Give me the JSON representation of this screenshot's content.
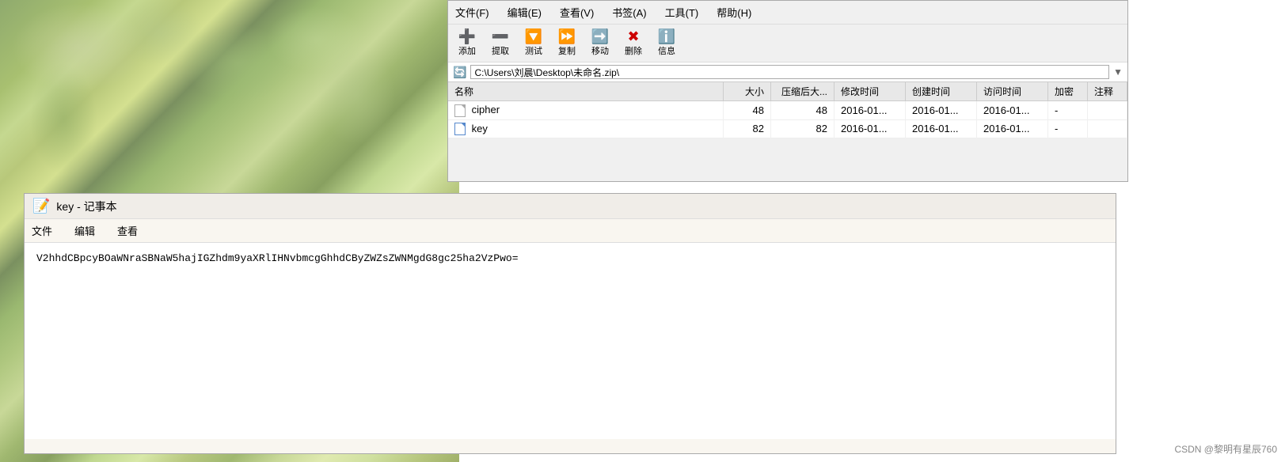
{
  "background": {
    "description": "Impressionist painting background"
  },
  "winrar": {
    "menubar": {
      "items": [
        "文件(F)",
        "编辑(E)",
        "查看(V)",
        "书签(A)",
        "工具(T)",
        "帮助(H)"
      ]
    },
    "toolbar": {
      "buttons": [
        {
          "label": "添加",
          "icon": "+",
          "color": "add"
        },
        {
          "label": "提取",
          "icon": "—",
          "color": "extract"
        },
        {
          "label": "测试",
          "icon": "✓",
          "color": "test"
        },
        {
          "label": "复制",
          "icon": "⇒",
          "color": "copy"
        },
        {
          "label": "移动",
          "icon": "→",
          "color": "move"
        },
        {
          "label": "删除",
          "icon": "✕",
          "color": "delete"
        },
        {
          "label": "信息",
          "icon": "ℹ",
          "color": "info"
        }
      ]
    },
    "path": "C:\\Users\\刘晨\\Desktop\\未命名.zip\\",
    "table": {
      "columns": [
        "名称",
        "大小",
        "压缩后大...",
        "修改时间",
        "创建时间",
        "访问时间",
        "加密",
        "注释"
      ],
      "rows": [
        {
          "name": "cipher",
          "size": "48",
          "compressed": "48",
          "modified": "2016-01...",
          "created": "2016-01...",
          "accessed": "2016-01...",
          "encrypted": "-",
          "comment": ""
        },
        {
          "name": "key",
          "size": "82",
          "compressed": "82",
          "modified": "2016-01...",
          "created": "2016-01...",
          "accessed": "2016-01...",
          "encrypted": "-",
          "comment": ""
        }
      ]
    }
  },
  "notepad": {
    "title": "key - 记事本",
    "icon": "📝",
    "menubar": {
      "items": [
        "文件",
        "编辑",
        "查看"
      ]
    },
    "content": "V2hhdCBpcyBOaWNraSBNaW5hajIGZhdm9yaXRlIHNvbmcgGhhdCByZWZsZWNMgdG8gc25ha2VzPwo="
  },
  "watermark": "CSDN @黎明有星辰760"
}
